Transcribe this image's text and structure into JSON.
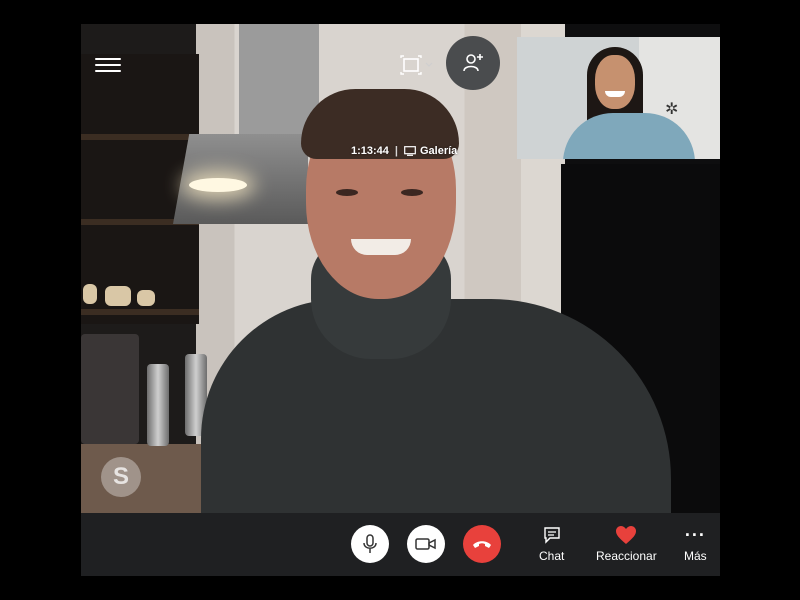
{
  "call": {
    "duration": "1:13:44",
    "separator": "|",
    "view_mode": "Galería"
  },
  "controls": {
    "chat_label": "Chat",
    "react_label": "Reaccionar",
    "more_label": "Más",
    "more_glyph": "···",
    "skype_letter": "S"
  },
  "icons": {
    "menu": "hamburger-menu-icon",
    "layout": "fullscreen-icon",
    "add_person": "add-person-icon",
    "gallery": "gallery-icon",
    "mic": "microphone-icon",
    "camera": "video-camera-icon",
    "hangup": "hang-up-icon",
    "chat": "chat-bubble-icon",
    "react": "heart-icon",
    "more": "more-dots-icon"
  },
  "colors": {
    "hangup": "#e8413c",
    "heart": "#e8413c",
    "toolbar": "#1f2022"
  }
}
